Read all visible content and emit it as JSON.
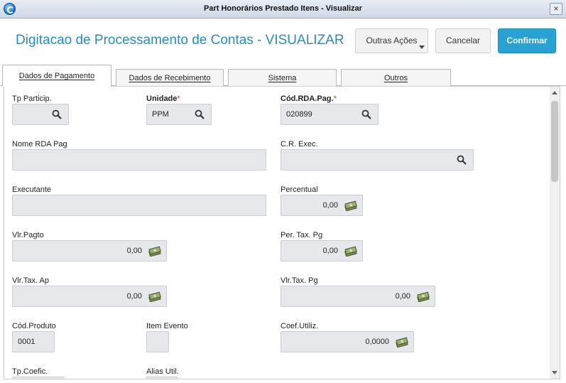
{
  "window": {
    "title": "Part Honorários Prestado Itens - Visualizar",
    "close_label": "×"
  },
  "header": {
    "title": "Digitacao de Processamento de Contas - VISUALIZAR",
    "buttons": {
      "other_actions": "Outras Ações",
      "cancel": "Cancelar",
      "confirm": "Confirmar"
    }
  },
  "tabs": [
    {
      "label": "Dados de Pagamento",
      "active": true
    },
    {
      "label": "Dados de Recebimento",
      "active": false
    },
    {
      "label": "Sistema",
      "active": false
    },
    {
      "label": "Outros",
      "active": false
    }
  ],
  "form": {
    "tp_particip": {
      "label": "Tp Particip.",
      "value": ""
    },
    "unidade": {
      "label": "Unidade",
      "required_mark": "*",
      "value": "PPM"
    },
    "cod_rda_pag": {
      "label": "Cód.RDA.Pag.",
      "required_mark": "*",
      "value": "020899"
    },
    "nome_rda_pag": {
      "label": "Nome RDA Pag",
      "value": ""
    },
    "cr_exec": {
      "label": "C.R. Exec.",
      "value": ""
    },
    "executante": {
      "label": "Executante",
      "value": ""
    },
    "percentual": {
      "label": "Percentual",
      "value": "0,00"
    },
    "vlr_pagto": {
      "label": "Vlr.Pagto",
      "value": "0,00"
    },
    "per_tax_pg": {
      "label": "Per. Tax. Pg",
      "value": "0,00"
    },
    "vlr_tax_ap": {
      "label": "Vlr.Tax. Ap",
      "value": "0,00"
    },
    "vlr_tax_pg": {
      "label": "Vlr.Tax. Pg",
      "value": "0,00"
    },
    "cod_produto": {
      "label": "Cód.Produto",
      "value": "0001"
    },
    "item_evento": {
      "label": "Item Evento",
      "value": ""
    },
    "coef_utiliz": {
      "label": "Coef.Utiliz.",
      "value": "0,0000"
    },
    "tp_coefic": {
      "label": "Tp.Coefic.",
      "value": ""
    },
    "alias_util": {
      "label": "Alias Util.",
      "value": ""
    }
  },
  "colors": {
    "accent": "#28a2d2",
    "title": "#2a8bc0",
    "required": "#e0252b",
    "field_bg": "#e6e8ec"
  }
}
